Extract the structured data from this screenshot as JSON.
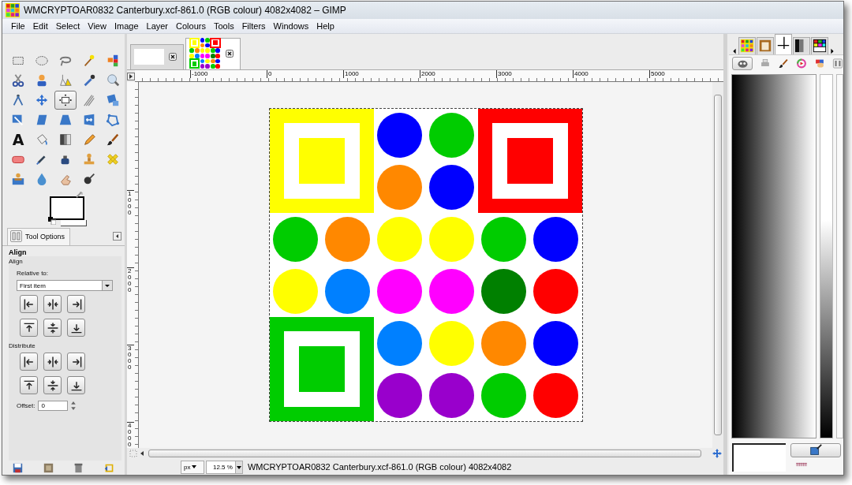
{
  "window": {
    "title": "WMCRYPTOAR0832 Canterbury.xcf-861.0 (RGB colour) 4082x4082 – GIMP"
  },
  "menu": [
    "File",
    "Edit",
    "Select",
    "View",
    "Image",
    "Layer",
    "Colours",
    "Tools",
    "Filters",
    "Windows",
    "Help"
  ],
  "tools": [
    {
      "selected": false
    },
    {
      "selected": false
    },
    {
      "selected": false
    },
    {
      "selected": false
    },
    {
      "selected": false
    },
    {
      "selected": false
    },
    {
      "selected": false
    },
    {
      "selected": false
    },
    {
      "selected": false
    },
    {
      "selected": false
    },
    {
      "selected": false
    },
    {
      "selected": false
    },
    {
      "selected": true
    },
    {
      "selected": false
    },
    {
      "selected": false
    },
    {
      "selected": false
    },
    {
      "selected": false
    },
    {
      "selected": false
    },
    {
      "selected": false
    },
    {
      "selected": false
    },
    {
      "glyph": "A",
      "selected": false
    },
    {
      "selected": false
    },
    {
      "selected": false
    },
    {
      "selected": false
    },
    {
      "selected": false
    },
    {
      "selected": false
    },
    {
      "selected": false
    },
    {
      "selected": false
    },
    {
      "selected": false
    },
    {
      "selected": false
    },
    {
      "selected": false
    },
    {
      "selected": false
    },
    {
      "selected": false
    },
    {
      "selected": false
    }
  ],
  "tool_options": {
    "tab": "Tool Options",
    "title": "Align",
    "section": "Align",
    "relative_label": "Relative to:",
    "relative_value": "First item",
    "distribute_label": "Distribute",
    "offset_label": "Offset:",
    "offset_value": "0"
  },
  "image_tabs": [
    {
      "kind": "blank",
      "selected": false
    },
    {
      "kind": "image",
      "selected": true
    }
  ],
  "ruler": {
    "horizontal": [
      "-1000",
      "0",
      "1000",
      "2000",
      "3000",
      "4000",
      "5000"
    ],
    "vertical": [
      "1000",
      "2000",
      "3000",
      "4000"
    ]
  },
  "image": {
    "shapes": [
      {
        "kind": "square",
        "color": "#ffff00"
      },
      {
        "kind": "circle",
        "color": "#0000ff"
      },
      {
        "kind": "circle",
        "color": "#00cc00"
      },
      {
        "kind": "square",
        "color": "#ff0000"
      },
      {
        "kind": "circle",
        "color": "#ff8800"
      },
      {
        "kind": "circle",
        "color": "#0000ff"
      },
      {
        "kind": "circle",
        "color": "#00cc00"
      },
      {
        "kind": "circle",
        "color": "#ff8800"
      },
      {
        "kind": "circle",
        "color": "#ffff00"
      },
      {
        "kind": "circle",
        "color": "#ffff00"
      },
      {
        "kind": "circle",
        "color": "#00cc00"
      },
      {
        "kind": "circle",
        "color": "#0000ff"
      },
      {
        "kind": "circle",
        "color": "#ffff00"
      },
      {
        "kind": "circle",
        "color": "#0080ff"
      },
      {
        "kind": "circle",
        "color": "#ff00ff"
      },
      {
        "kind": "circle",
        "color": "#ff00ff"
      },
      {
        "kind": "circle",
        "color": "#008000"
      },
      {
        "kind": "circle",
        "color": "#ff0000"
      },
      {
        "kind": "square",
        "color": "#00cc00"
      },
      {
        "kind": "circle",
        "color": "#0080ff"
      },
      {
        "kind": "circle",
        "color": "#ffff00"
      },
      {
        "kind": "circle",
        "color": "#ff8800"
      },
      {
        "kind": "circle",
        "color": "#0000ff"
      },
      {
        "kind": "circle",
        "color": "#9900cc"
      },
      {
        "kind": "circle",
        "color": "#9900cc"
      },
      {
        "kind": "circle",
        "color": "#00cc00"
      },
      {
        "kind": "circle",
        "color": "#ff0000"
      }
    ]
  },
  "dock": {
    "tabs": [
      {
        "selected": false
      },
      {
        "selected": false
      },
      {
        "selected": true
      },
      {
        "selected": false
      },
      {
        "selected": false
      }
    ]
  },
  "status_bar": {
    "unit": "px",
    "zoom": "12.5 %",
    "text": "WMCRYPTOAR0832 Canterbury.xcf-861.0 (RGB colour) 4082x4082"
  }
}
